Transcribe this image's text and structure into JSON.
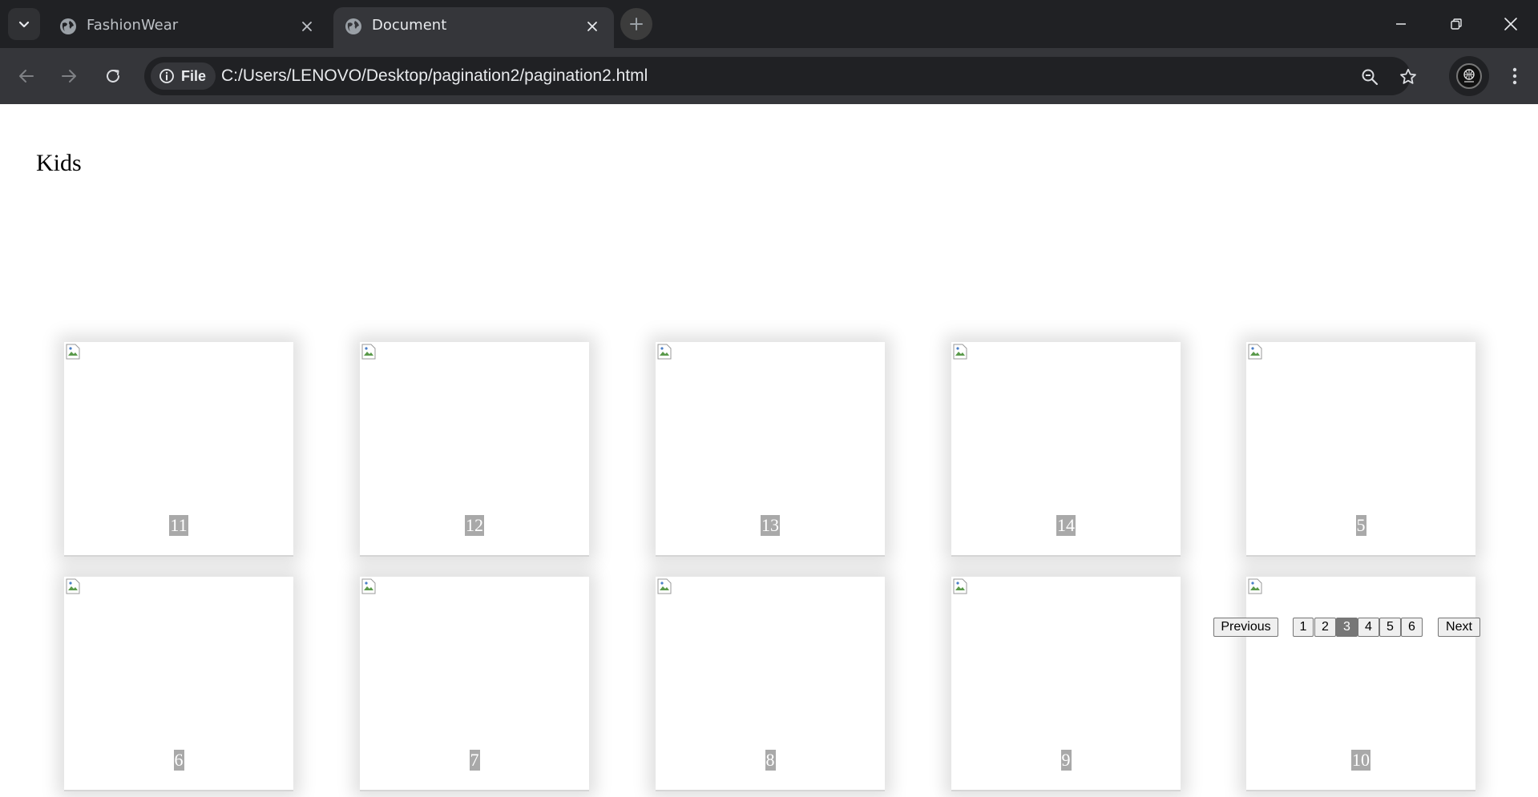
{
  "browser": {
    "tabs": [
      {
        "title": "FashionWear",
        "active": false
      },
      {
        "title": "Document",
        "active": true
      }
    ],
    "address_bar": {
      "site_chip": "File",
      "url": "C:/Users/LENOVO/Desktop/pagination2/pagination2.html"
    }
  },
  "page": {
    "heading": "Kids",
    "items": [
      {
        "label": "11"
      },
      {
        "label": "12"
      },
      {
        "label": "13"
      },
      {
        "label": "14"
      },
      {
        "label": "5"
      },
      {
        "label": "6"
      },
      {
        "label": "7"
      },
      {
        "label": "8"
      },
      {
        "label": "9"
      },
      {
        "label": "10"
      }
    ],
    "pagination": {
      "previous_label": "Previous",
      "next_label": "Next",
      "pages": [
        "1",
        "2",
        "3",
        "4",
        "5",
        "6"
      ],
      "current_page": "3"
    }
  },
  "colors": {
    "tabstrip_bg": "#202124",
    "toolbar_bg": "#35363a",
    "label_bg": "#a9a9a9",
    "current_page_bg": "#777777"
  }
}
